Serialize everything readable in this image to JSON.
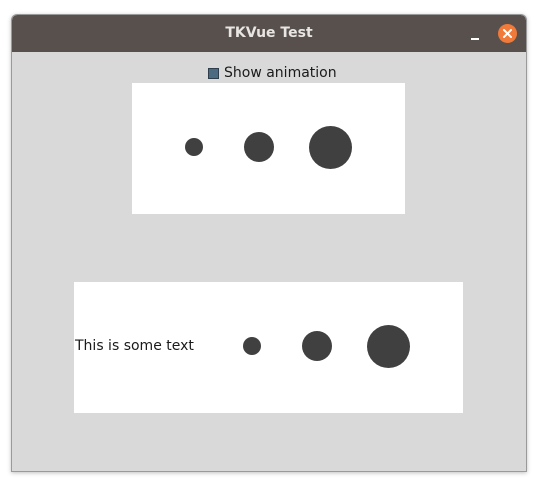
{
  "window": {
    "title": "TKVue Test",
    "minimize_icon": "minimize-icon",
    "close_icon": "close-icon",
    "close_color": "#f07a3a",
    "titlebar_color": "#58504c"
  },
  "animation_toggle": {
    "label": "Show animation",
    "checked": true
  },
  "panel_top": {
    "dots": [
      "small-dot",
      "medium-dot",
      "large-dot"
    ]
  },
  "panel_bottom": {
    "text": "This is some text",
    "dots": [
      "small-dot",
      "medium-dot",
      "large-dot"
    ]
  },
  "dot_color": "#404040"
}
